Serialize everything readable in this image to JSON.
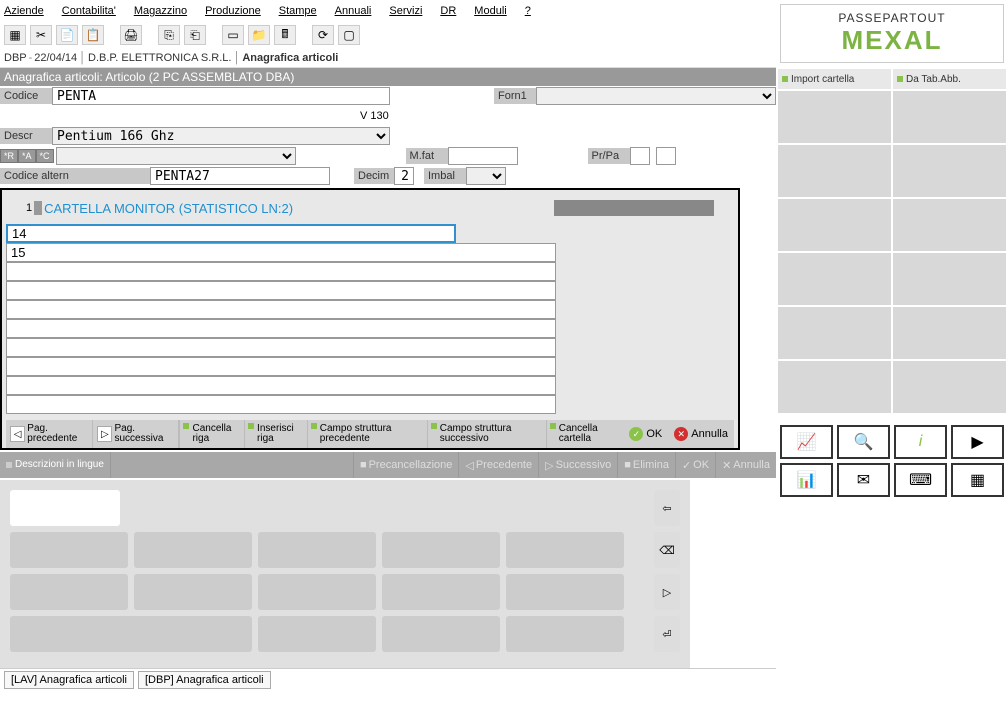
{
  "menu": {
    "items": [
      "Aziende",
      "Contabilita'",
      "Magazzino",
      "Produzione",
      "Stampe",
      "Annuali",
      "Servizi",
      "DR",
      "Moduli",
      "?"
    ]
  },
  "breadcrumb": {
    "db": "DBP",
    "date": "22/04/14",
    "company": "D.B.P. ELETTRONICA S.R.L.",
    "context": "Anagrafica articoli"
  },
  "header": {
    "title": "Anagrafica articoli: Articolo (2 PC ASSEMBLATO DBA)"
  },
  "form": {
    "codice_label": "Codice",
    "codice_value": "PENTA",
    "version_label": "V 130",
    "forn_label": "Forn1",
    "forn_value": "",
    "descr_label": "Descr",
    "descr_value": "Pentium 166 Ghz",
    "tags": [
      "*R",
      "*A",
      "*C"
    ],
    "codice_altern_label": "Codice altern",
    "codice_altern_value": "PENTA27",
    "decim_label": "Decim",
    "decim_value": "2",
    "mfat_label": "M.fat",
    "mfat_value": "",
    "prpa_label": "Pr/Pa",
    "imbal_label": "Imbal",
    "imbal_value": ""
  },
  "inner": {
    "index": "1",
    "title": "CARTELLA MONITOR (STATISTICO LN:2)",
    "lines": [
      "14",
      "15",
      "",
      "",
      "",
      "",
      "",
      "",
      "",
      ""
    ],
    "buttons": {
      "pag_prec": "Pag. precedente",
      "pag_succ": "Pag. successiva",
      "cancella_riga": "Cancella riga",
      "inserisci_riga": "Inserisci riga",
      "campo_prec": "Campo struttura precedente",
      "campo_succ": "Campo struttura successivo",
      "cancella_cartella": "Cancella cartella",
      "ok": "OK",
      "annulla": "Annulla"
    }
  },
  "disabled_bar": {
    "tab": "Descrizioni in lingue",
    "precancel": "Precancellazione",
    "prec": "Precedente",
    "succ": "Successivo",
    "elimina": "Elimina",
    "ok": "OK",
    "annulla": "Annulla"
  },
  "bottom_tabs": {
    "t1_code": "[LAV]",
    "t1_label": "Anagrafica articoli",
    "t2_code": "[DBP]",
    "t2_label": "Anagrafica articoli"
  },
  "right": {
    "logo_top": "PASSEPARTOUT",
    "logo_bottom": "MEXAL",
    "headers": [
      "Import cartella",
      "Da Tab.Abb."
    ]
  }
}
